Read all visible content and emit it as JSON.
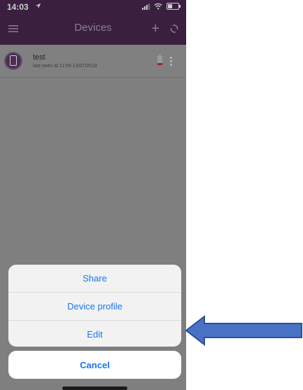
{
  "status_bar": {
    "time": "14:03"
  },
  "nav": {
    "title": "Devices",
    "add_symbol": "+"
  },
  "device": {
    "name": "test",
    "last_seen": "last seen at 11:59 13/07/2018",
    "battery_level": 0.25
  },
  "action_sheet": {
    "items": [
      "Share",
      "Device profile",
      "Edit"
    ],
    "cancel": "Cancel"
  },
  "colors": {
    "header": "#3a1f3f",
    "overlay": "#7f7f7f",
    "action_text": "#1877f2",
    "arrow": "#4a72c4",
    "battery_low": "#b01a1a"
  },
  "icons": [
    "location-icon",
    "signal-icon",
    "wifi-icon",
    "battery-icon",
    "menu-icon",
    "add-icon",
    "refresh-icon",
    "device-avatar-icon",
    "battery-low-icon",
    "more-icon",
    "arrow-left-icon"
  ]
}
